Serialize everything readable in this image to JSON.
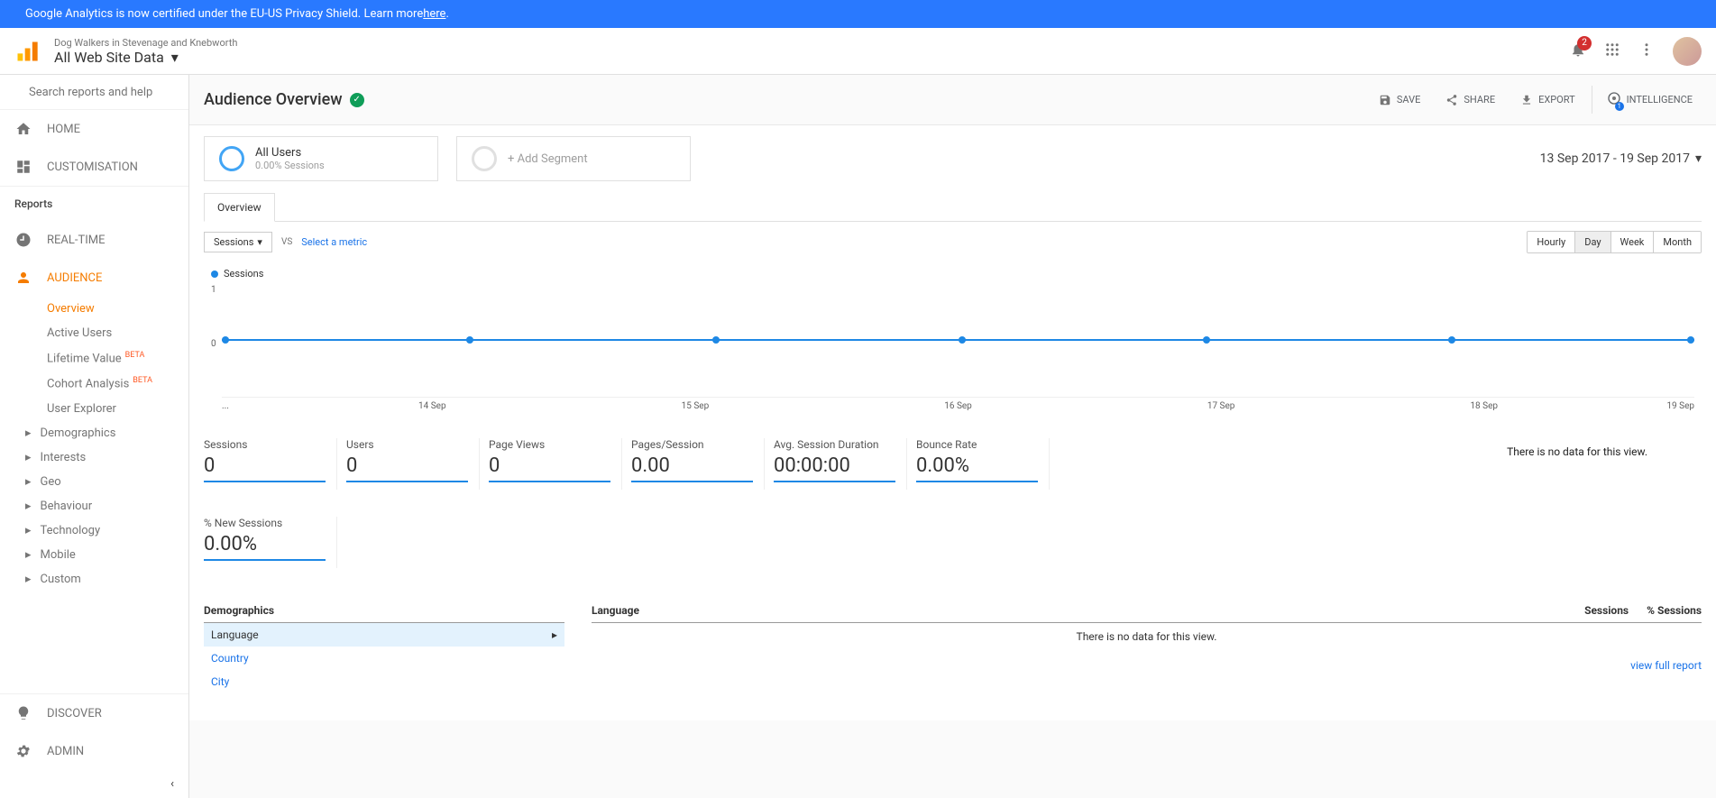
{
  "banner": {
    "text": "Google Analytics is now certified under the EU-US Privacy Shield. Learn more ",
    "link": "here"
  },
  "header": {
    "property": "Dog Walkers in Stevenage and Knebworth",
    "view": "All Web Site Data",
    "notif_count": "2",
    "intel_count": "1"
  },
  "search": {
    "placeholder": "Search reports and help"
  },
  "nav": {
    "home": "HOME",
    "customisation": "CUSTOMISATION",
    "reports_label": "Reports",
    "realtime": "REAL-TIME",
    "audience": "AUDIENCE",
    "discover": "DISCOVER",
    "admin": "ADMIN",
    "audience_items": {
      "overview": "Overview",
      "active": "Active Users",
      "lifetime": "Lifetime Value",
      "cohort": "Cohort Analysis",
      "explorer": "User Explorer",
      "demographics": "Demographics",
      "interests": "Interests",
      "geo": "Geo",
      "behaviour": "Behaviour",
      "technology": "Technology",
      "mobile": "Mobile",
      "custom": "Custom"
    },
    "beta": "BETA"
  },
  "page": {
    "title": "Audience Overview",
    "save": "SAVE",
    "share": "SHARE",
    "export": "EXPORT",
    "intelligence": "INTELLIGENCE"
  },
  "segments": {
    "all_users": "All Users",
    "all_users_sub": "0.00% Sessions",
    "add": "+ Add Segment"
  },
  "date_range": "13 Sep 2017 - 19 Sep 2017",
  "tabs": {
    "overview": "Overview"
  },
  "controls": {
    "metric": "Sessions",
    "vs": "VS",
    "select": "Select a metric",
    "hourly": "Hourly",
    "day": "Day",
    "week": "Week",
    "month": "Month",
    "legend": "Sessions"
  },
  "chart_data": {
    "type": "line",
    "title": "Sessions",
    "xlabel": "",
    "ylabel": "",
    "ylim": [
      0,
      1
    ],
    "y_ticks": [
      "1",
      "0"
    ],
    "x": [
      "...",
      "14 Sep",
      "15 Sep",
      "16 Sep",
      "17 Sep",
      "18 Sep",
      "19 Sep"
    ],
    "series": [
      {
        "name": "Sessions",
        "values": [
          0,
          0,
          0,
          0,
          0,
          0,
          0
        ]
      }
    ]
  },
  "metrics": [
    {
      "label": "Sessions",
      "value": "0"
    },
    {
      "label": "Users",
      "value": "0"
    },
    {
      "label": "Page Views",
      "value": "0"
    },
    {
      "label": "Pages/Session",
      "value": "0.00"
    },
    {
      "label": "Avg. Session Duration",
      "value": "00:00:00"
    },
    {
      "label": "Bounce Rate",
      "value": "0.00%"
    }
  ],
  "metric2": {
    "label": "% New Sessions",
    "value": "0.00%"
  },
  "nodata": "There is no data for this view.",
  "demo": {
    "title": "Demographics",
    "rows": [
      {
        "label": "Language",
        "active": true
      },
      {
        "label": "Country",
        "active": false
      },
      {
        "label": "City",
        "active": false
      }
    ]
  },
  "data_table": {
    "col1": "Language",
    "col2": "Sessions",
    "col3": "% Sessions",
    "empty": "There is no data for this view.",
    "full_report": "view full report"
  }
}
